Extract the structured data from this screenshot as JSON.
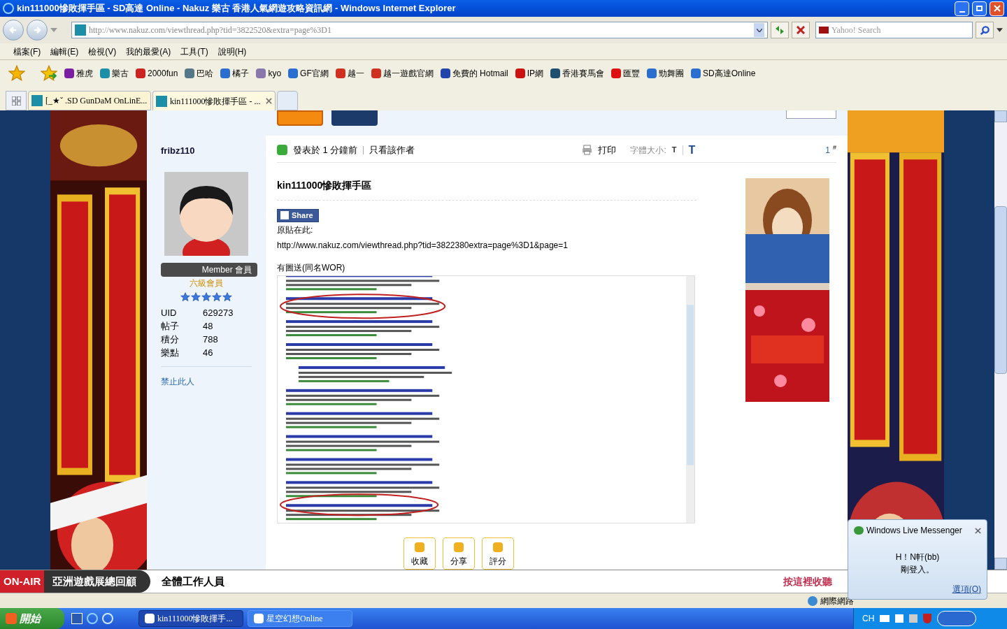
{
  "window": {
    "title": "kin111000慘敗揮手區 - SD高達 Online - Nakuz 樂古 香港人氣網遊攻略資訊網 - Windows Internet Explorer"
  },
  "address_bar": {
    "url": "http://www.nakuz.com/viewthread.php?tid=3822520&extra=page%3D1"
  },
  "search_box": {
    "placeholder": "Yahoo! Search"
  },
  "menu": [
    "檔案(F)",
    "編輯(E)",
    "檢視(V)",
    "我的最愛(A)",
    "工具(T)",
    "說明(H)"
  ],
  "favorites": [
    {
      "label": "雅虎",
      "color": "#7b1fa2"
    },
    {
      "label": "樂古",
      "color": "#1c8fa8"
    },
    {
      "label": "2000fun",
      "color": "#cc2222"
    },
    {
      "label": "巴哈",
      "color": "#557788"
    },
    {
      "label": "橘子",
      "color": "#2a6fd0"
    },
    {
      "label": "kyo",
      "color": "#8877aa"
    },
    {
      "label": "GF官網",
      "color": "#2a6fd0"
    },
    {
      "label": "越一",
      "color": "#d03020"
    },
    {
      "label": "越一遊戲官網",
      "color": "#d03020"
    },
    {
      "label": "免費的 Hotmail",
      "color": "#2244aa"
    },
    {
      "label": "IP網",
      "color": "#cc1111"
    },
    {
      "label": "香港賽馬會",
      "color": "#1f4f6f"
    },
    {
      "label": "匯豐",
      "color": "#dd1111"
    },
    {
      "label": "勁舞團",
      "color": "#2a6fd0"
    },
    {
      "label": "SD高達Online",
      "color": "#2a6fd0"
    }
  ],
  "tabs": [
    {
      "label": "[_★ˇ .SD GunDaM OnLinE...",
      "selected": false
    },
    {
      "label": "kin111000慘敗揮手區 - ...",
      "selected": true
    }
  ],
  "post": {
    "author": "fribz110",
    "rank_badge": "Member 會員",
    "rank": "六級會員",
    "stars": 5,
    "stats": [
      {
        "label": "UID",
        "value": "629273"
      },
      {
        "label": "帖子",
        "value": "48"
      },
      {
        "label": "積分",
        "value": "788"
      },
      {
        "label": "樂點",
        "value": "46"
      }
    ],
    "ban_link": "禁止此人",
    "posted": "發表於 1 分鐘前",
    "author_only": "只看該作者",
    "print": "打印",
    "font_size_label": "字體大小:",
    "font_small": "T",
    "font_large": "T",
    "floor": "1",
    "floor_mark": "#",
    "title": "kin111000慘敗揮手區",
    "share": "Share",
    "source_label": "原貼在此:",
    "source_url": "http://www.nakuz.com/viewthread.php?tid=3822380extra=page%3D1&page=1",
    "caption": "有圖送(同名WOR)",
    "actions": [
      "收藏",
      "分享",
      "評分"
    ]
  },
  "radio_bar": {
    "badge": "ON-AIR",
    "program": "亞洲遊戲展總回顧",
    "staff": "全體工作人員",
    "listen": "按這裡收聽"
  },
  "status_bar": {
    "zone": "網際網路"
  },
  "messenger": {
    "title": "Windows Live Messenger",
    "name": "H！N軒(bb)",
    "message": "剛登入。",
    "options": "選項(O)"
  },
  "taskbar": {
    "start": "開始",
    "windows": [
      {
        "label": "kin111000慘敗揮手...",
        "selected": true
      },
      {
        "label": "星空幻想Online",
        "selected": false
      }
    ],
    "lang": "CH"
  }
}
